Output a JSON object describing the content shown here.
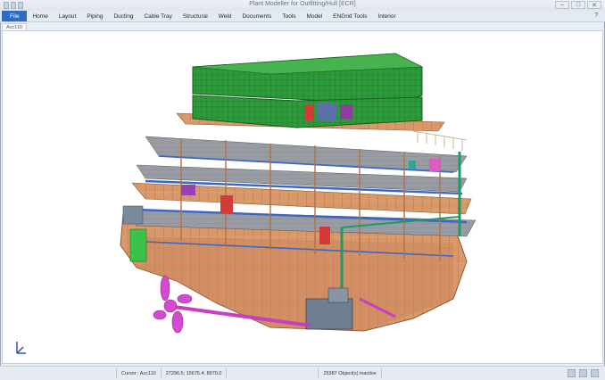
{
  "window": {
    "title": "Plant Modeller for Outfitting/Hull [ECR]",
    "quick_access_icons": [
      "save-icon",
      "undo-icon",
      "redo-icon"
    ],
    "controls": {
      "minimize": "–",
      "maximize": "□",
      "close": "✕"
    }
  },
  "menubar": {
    "file": "File",
    "items": [
      "Home",
      "Layout",
      "Piping",
      "Ducting",
      "Cable Tray",
      "Structural",
      "Weld",
      "Documents",
      "Tools",
      "Model",
      "ENGrid Tools",
      "Interior"
    ],
    "help": "?"
  },
  "document_tab": {
    "label": "Acc110"
  },
  "viewport": {
    "content": "3D ship hull and outfitting model",
    "colors": {
      "hull": "#d8986a",
      "accommodation_blocks": "#2f9a3c",
      "propeller": "#d44ad0",
      "piping": "#1f9a66",
      "deck": "#8d8f97"
    }
  },
  "statusbar": {
    "cursor_label": "Cursor : Acc110",
    "coordinates": "27296.5; 15675.4; 8970.0",
    "object_count": "25387 Object(s) inactive"
  }
}
